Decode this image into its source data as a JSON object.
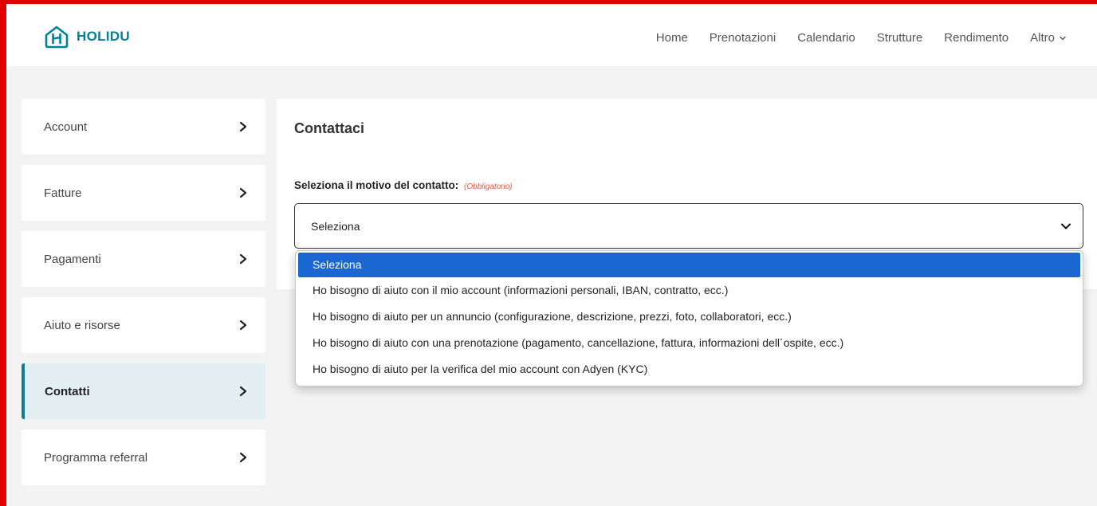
{
  "brand": {
    "name": "HOLIDU",
    "color": "#00809d"
  },
  "nav": {
    "items": [
      "Home",
      "Prenotazioni",
      "Calendario",
      "Strutture",
      "Rendimento"
    ],
    "more_label": "Altro"
  },
  "sidebar": {
    "items": [
      {
        "label": "Account"
      },
      {
        "label": "Fatture"
      },
      {
        "label": "Pagamenti"
      },
      {
        "label": "Aiuto e risorse"
      },
      {
        "label": "Contatti",
        "active": true
      },
      {
        "label": "Programma referral"
      }
    ]
  },
  "main": {
    "title": "Contattaci",
    "field_label": "Seleziona il motivo del contatto:",
    "required_label": "(Obbligatorio)",
    "select_value": "Seleziona"
  },
  "dropdown": {
    "options": [
      "Seleziona",
      "Ho bisogno di aiuto con il mio account (informazioni personali, IBAN, contratto, ecc.)",
      "Ho bisogno di aiuto per un annuncio (configurazione, descrizione, prezzi, foto, collaboratori, ecc.)",
      "Ho bisogno di aiuto con una prenotazione (pagamento, cancellazione, fattura, informazioni dell´ospite, ecc.)",
      "Ho bisogno di aiuto per la verifica del mio account con Adyen (KYC)"
    ],
    "selected_index": 0
  },
  "colors": {
    "accent": "#0f7b93",
    "highlight": "#1a67d2",
    "frame": "#e00000",
    "required": "#e05a3a"
  }
}
